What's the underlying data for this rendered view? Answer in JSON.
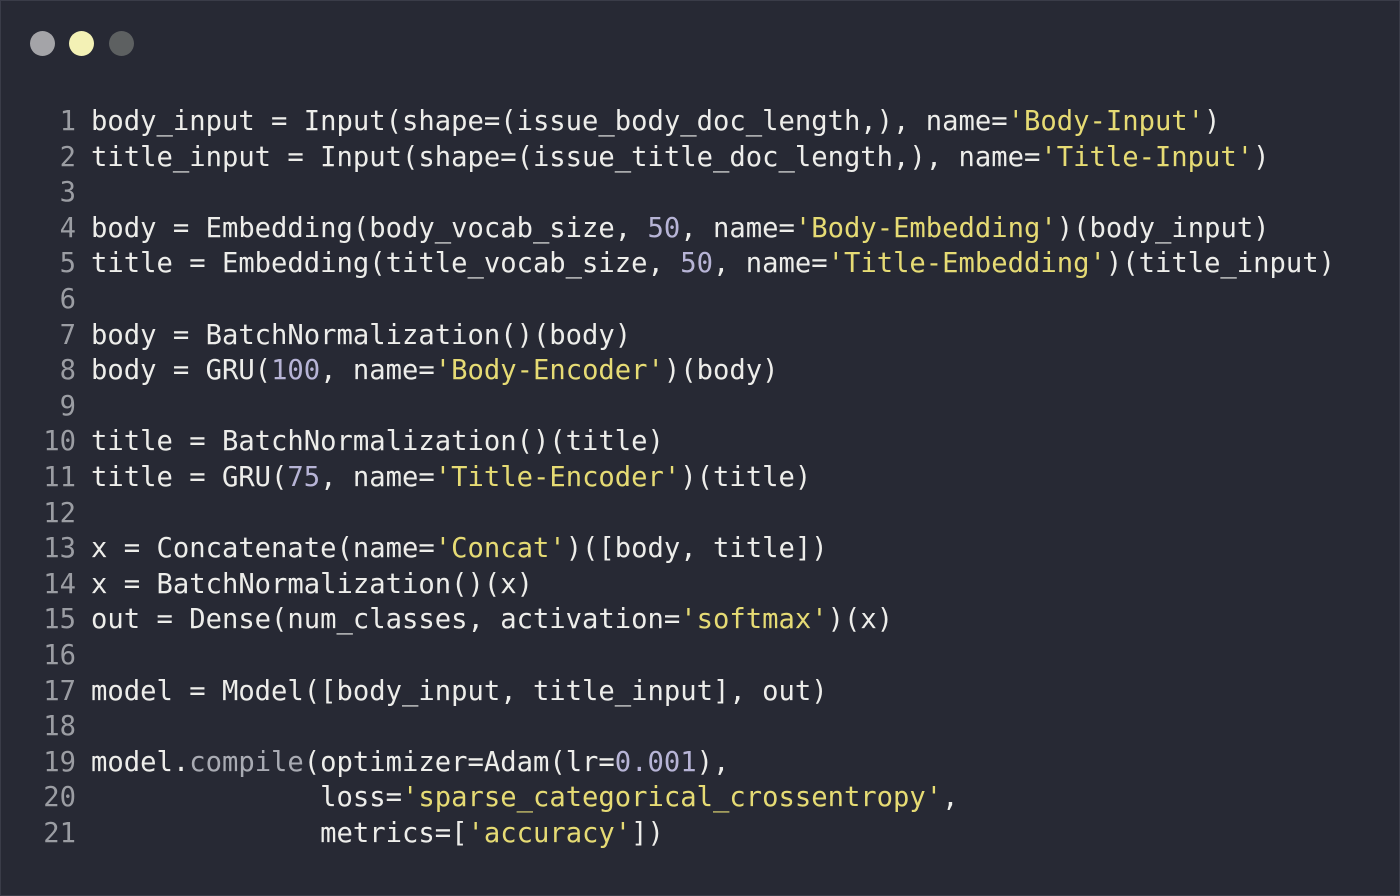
{
  "window": {
    "buttons": [
      {
        "name": "close",
        "color": "#a4a4a8"
      },
      {
        "name": "minimize",
        "color": "#f3f1b5"
      },
      {
        "name": "maximize",
        "color": "#5d6061"
      }
    ]
  },
  "code": {
    "lines": [
      {
        "num": "1",
        "tokens": [
          {
            "t": "body_input = Input(shape=(issue_body_doc_length,), name="
          },
          {
            "t": "'Body-Input'",
            "k": "str"
          },
          {
            "t": ")"
          }
        ]
      },
      {
        "num": "2",
        "tokens": [
          {
            "t": "title_input = Input(shape=(issue_title_doc_length,), name="
          },
          {
            "t": "'Title-Input'",
            "k": "str"
          },
          {
            "t": ")"
          }
        ]
      },
      {
        "num": "3",
        "tokens": []
      },
      {
        "num": "4",
        "tokens": [
          {
            "t": "body = Embedding(body_vocab_size, "
          },
          {
            "t": "50",
            "k": "num"
          },
          {
            "t": ", name="
          },
          {
            "t": "'Body-Embedding'",
            "k": "str"
          },
          {
            "t": ")(body_input)"
          }
        ]
      },
      {
        "num": "5",
        "tokens": [
          {
            "t": "title = Embedding(title_vocab_size, "
          },
          {
            "t": "50",
            "k": "num"
          },
          {
            "t": ", name="
          },
          {
            "t": "'Title-Embedding'",
            "k": "str"
          },
          {
            "t": ")(title_input)"
          }
        ]
      },
      {
        "num": "6",
        "tokens": []
      },
      {
        "num": "7",
        "tokens": [
          {
            "t": "body = BatchNormalization()(body)"
          }
        ]
      },
      {
        "num": "8",
        "tokens": [
          {
            "t": "body = GRU("
          },
          {
            "t": "100",
            "k": "num"
          },
          {
            "t": ", name="
          },
          {
            "t": "'Body-Encoder'",
            "k": "str"
          },
          {
            "t": ")(body)"
          }
        ]
      },
      {
        "num": "9",
        "tokens": []
      },
      {
        "num": "10",
        "tokens": [
          {
            "t": "title = BatchNormalization()(title)"
          }
        ]
      },
      {
        "num": "11",
        "tokens": [
          {
            "t": "title = GRU("
          },
          {
            "t": "75",
            "k": "num"
          },
          {
            "t": ", name="
          },
          {
            "t": "'Title-Encoder'",
            "k": "str"
          },
          {
            "t": ")(title)"
          }
        ]
      },
      {
        "num": "12",
        "tokens": []
      },
      {
        "num": "13",
        "tokens": [
          {
            "t": "x = Concatenate(name="
          },
          {
            "t": "'Concat'",
            "k": "str"
          },
          {
            "t": ")([body, title])"
          }
        ]
      },
      {
        "num": "14",
        "tokens": [
          {
            "t": "x = BatchNormalization()(x)"
          }
        ]
      },
      {
        "num": "15",
        "tokens": [
          {
            "t": "out = Dense(num_classes, activation="
          },
          {
            "t": "'softmax'",
            "k": "str"
          },
          {
            "t": ")(x)"
          }
        ]
      },
      {
        "num": "16",
        "tokens": []
      },
      {
        "num": "17",
        "tokens": [
          {
            "t": "model = Model([body_input, title_input], out)"
          }
        ]
      },
      {
        "num": "18",
        "tokens": []
      },
      {
        "num": "19",
        "tokens": [
          {
            "t": "model."
          },
          {
            "t": "compile",
            "k": "fn"
          },
          {
            "t": "(optimizer=Adam(lr="
          },
          {
            "t": "0.001",
            "k": "num"
          },
          {
            "t": "),"
          }
        ]
      },
      {
        "num": "20",
        "tokens": [
          {
            "t": "              loss="
          },
          {
            "t": "'sparse_categorical_crossentropy'",
            "k": "str"
          },
          {
            "t": ","
          }
        ]
      },
      {
        "num": "21",
        "tokens": [
          {
            "t": "              metrics=["
          },
          {
            "t": "'accuracy'",
            "k": "str"
          },
          {
            "t": "])"
          }
        ]
      }
    ]
  }
}
